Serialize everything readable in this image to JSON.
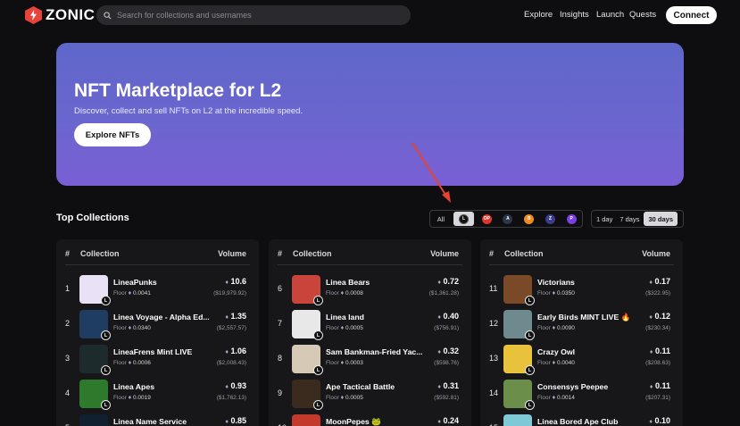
{
  "header": {
    "logo_text": "ZONIC",
    "search_placeholder": "Search for collections and usernames",
    "nav": [
      "Explore",
      "Insights",
      "Launch",
      "Quests"
    ],
    "connect_label": "Connect"
  },
  "hero": {
    "title": "NFT Marketplace for L2",
    "subtitle": "Discover, collect and sell NFTs on L2 at the incredible speed.",
    "button_label": "Explore NFTs"
  },
  "section": {
    "title": "Top Collections",
    "chain_all_label": "All",
    "chains": [
      {
        "icon": "linea-icon",
        "label": "L",
        "color": "#111111",
        "active": true
      },
      {
        "icon": "optimism-icon",
        "label": "OP",
        "color": "#e0342c"
      },
      {
        "icon": "arbitrum-icon",
        "label": "A",
        "color": "#2d374b"
      },
      {
        "icon": "base-icon",
        "label": "B",
        "color": "#f28a1e"
      },
      {
        "icon": "zksync-icon",
        "label": "Z",
        "color": "#3c3c8c"
      },
      {
        "icon": "polygon-zkevm-icon",
        "label": "P",
        "color": "#7b3fe4"
      }
    ],
    "periods": [
      "1 day",
      "7 days",
      "30 days"
    ],
    "active_period": "30 days"
  },
  "table": {
    "col_num": "#",
    "col_collection": "Collection",
    "col_volume": "Volume",
    "floor_label": "Floor",
    "eth_symbol": "♦",
    "columns": [
      [
        {
          "rank": "1",
          "name": "LineaPunks",
          "floor": "0.0041",
          "volume": "10.6",
          "usd": "($19,979.92)",
          "thumb": "#e9e2f7"
        },
        {
          "rank": "2",
          "name": "Linea Voyage - Alpha Ed...",
          "floor": "0.0340",
          "volume": "1.35",
          "usd": "($2,557.57)",
          "thumb": "#1f3c63"
        },
        {
          "rank": "3",
          "name": "LineaFrens Mint LIVE",
          "floor": "0.0006",
          "volume": "1.06",
          "usd": "($2,008.43)",
          "thumb": "#1e2b2d"
        },
        {
          "rank": "4",
          "name": "Linea Apes",
          "floor": "0.0019",
          "volume": "0.93",
          "usd": "($1,762.13)",
          "thumb": "#2e7a2c"
        },
        {
          "rank": "5",
          "name": "Linea Name Service",
          "floor": "",
          "volume": "0.85",
          "usd": "",
          "thumb": "#102030"
        }
      ],
      [
        {
          "rank": "6",
          "name": "Linea Bears",
          "floor": "0.0008",
          "volume": "0.72",
          "usd": "($1,361.28)",
          "thumb": "#c9443a"
        },
        {
          "rank": "7",
          "name": "Linea land",
          "floor": "0.0005",
          "volume": "0.40",
          "usd": "($756.91)",
          "thumb": "#e8e8e8"
        },
        {
          "rank": "8",
          "name": "Sam Bankman-Fried Yac...",
          "floor": "0.0003",
          "volume": "0.32",
          "usd": "($598.76)",
          "thumb": "#d6c9b5"
        },
        {
          "rank": "9",
          "name": "Ape Tactical Battle",
          "floor": "0.0005",
          "volume": "0.31",
          "usd": "($592.81)",
          "thumb": "#3b2a1e"
        },
        {
          "rank": "10",
          "name": "MoonPepes 🐸",
          "floor": "",
          "volume": "0.24",
          "usd": "",
          "thumb": "#c33a2d"
        }
      ],
      [
        {
          "rank": "11",
          "name": "Victorians",
          "floor": "0.0350",
          "volume": "0.17",
          "usd": "($322.95)",
          "thumb": "#7a4a28"
        },
        {
          "rank": "12",
          "name": "Early Birds MINT LIVE 🔥",
          "floor": "0.0090",
          "volume": "0.12",
          "usd": "($230.34)",
          "thumb": "#6f8a8f"
        },
        {
          "rank": "13",
          "name": "Crazy Owl",
          "floor": "0.0040",
          "volume": "0.11",
          "usd": "($208.63)",
          "thumb": "#e8c23a"
        },
        {
          "rank": "14",
          "name": "Consensys Peepee",
          "floor": "0.0014",
          "volume": "0.11",
          "usd": "($207.31)",
          "thumb": "#6b8f4a"
        },
        {
          "rank": "15",
          "name": "Linea Bored Ape Club",
          "floor": "",
          "volume": "0.10",
          "usd": "",
          "thumb": "#7fc8d8"
        }
      ]
    ]
  }
}
